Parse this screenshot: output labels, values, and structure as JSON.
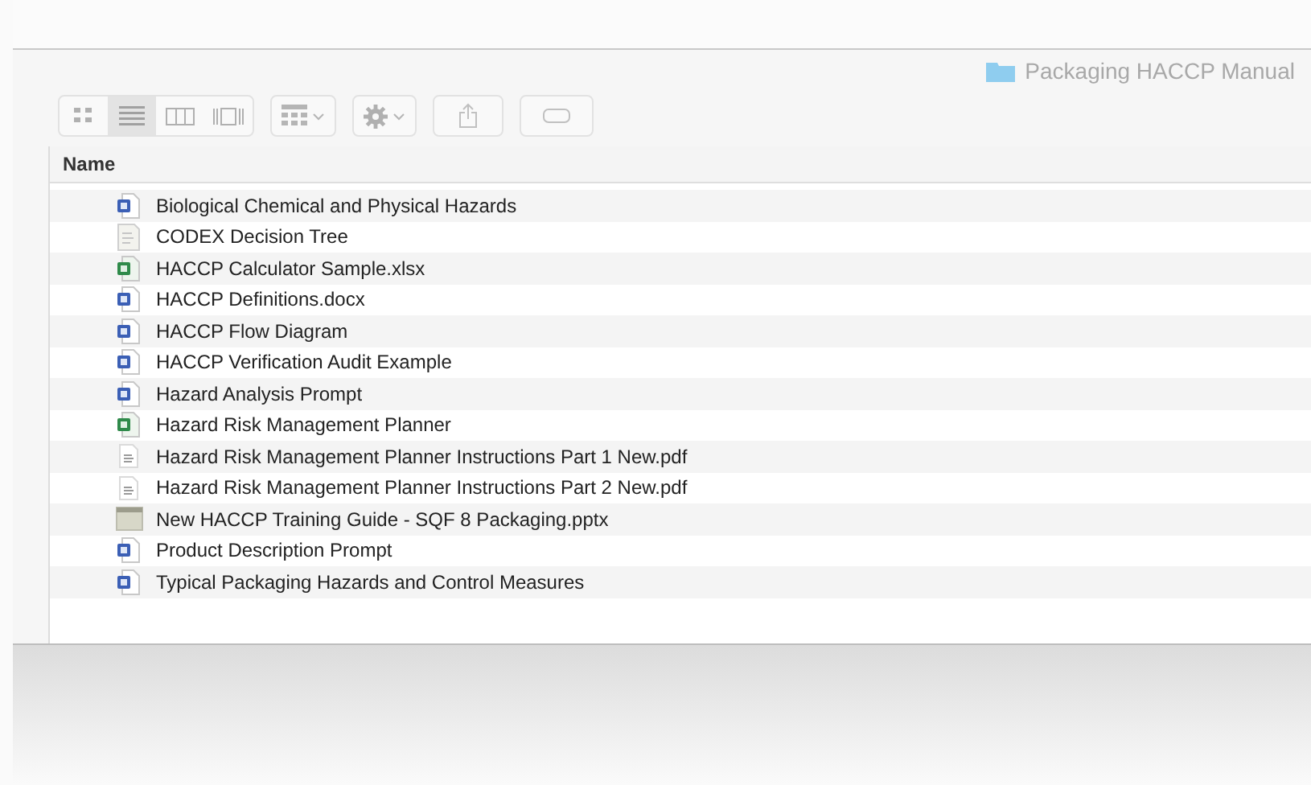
{
  "window": {
    "title": "Packaging HACCP Manual"
  },
  "view_buttons": [
    {
      "kind": "icons",
      "selected": false
    },
    {
      "kind": "list",
      "selected": true
    },
    {
      "kind": "columns",
      "selected": false
    },
    {
      "kind": "gallery",
      "selected": false
    }
  ],
  "columns": [
    "Name"
  ],
  "files": [
    {
      "name": "Biological Chemical and Physical Hazards",
      "kind": "word"
    },
    {
      "name": "CODEX Decision Tree",
      "kind": "text"
    },
    {
      "name": "HACCP Calculator Sample.xlsx",
      "kind": "excel"
    },
    {
      "name": "HACCP Definitions.docx",
      "kind": "word"
    },
    {
      "name": "HACCP Flow Diagram",
      "kind": "word"
    },
    {
      "name": "HACCP Verification Audit Example",
      "kind": "word"
    },
    {
      "name": "Hazard Analysis Prompt",
      "kind": "word"
    },
    {
      "name": "Hazard Risk Management Planner",
      "kind": "excel"
    },
    {
      "name": "Hazard Risk Management Planner Instructions Part 1 New.pdf",
      "kind": "pdf"
    },
    {
      "name": "Hazard Risk Management Planner Instructions Part 2 New.pdf",
      "kind": "pdf"
    },
    {
      "name": "New HACCP Training Guide - SQF 8 Packaging.pptx",
      "kind": "slides"
    },
    {
      "name": "Product Description Prompt",
      "kind": "word"
    },
    {
      "name": "Typical Packaging Hazards and Control Measures",
      "kind": "word"
    }
  ]
}
